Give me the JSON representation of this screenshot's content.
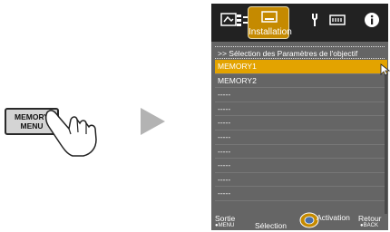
{
  "remote": {
    "line1": "MEMORY",
    "line2": "MENU"
  },
  "osd": {
    "tabs": {
      "active_label": "Installation"
    },
    "header": ">> Sélection des Paramètres de l'objectif",
    "items": [
      "MEMORY1",
      "MEMORY2",
      "-----",
      "-----",
      "-----",
      "-----",
      "-----",
      "-----",
      "-----",
      "-----"
    ],
    "footer": {
      "sortie": "Sortie",
      "menu": "●MENU",
      "selection": "Sélection",
      "activation": "Activation",
      "retour": "Retour",
      "back": "●BACK"
    }
  },
  "colors": {
    "highlight": "#e3a300",
    "osd_bg": "#656565",
    "tabbar_bg": "#222222"
  }
}
